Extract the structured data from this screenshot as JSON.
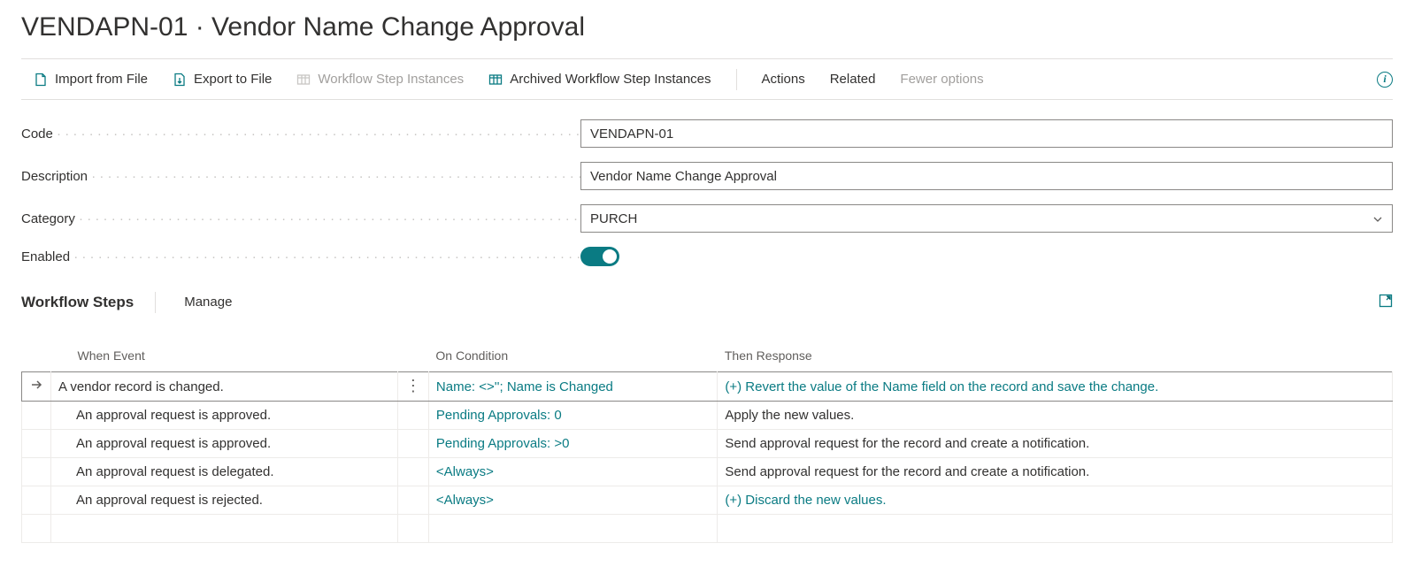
{
  "title": "VENDAPN-01 · Vendor Name Change Approval",
  "toolbar": {
    "import": "Import from File",
    "export": "Export to File",
    "wf_step_instances": "Workflow Step Instances",
    "archived_wf_step_instances": "Archived Workflow Step Instances",
    "actions": "Actions",
    "related": "Related",
    "fewer_options": "Fewer options"
  },
  "form": {
    "code_label": "Code",
    "code_value": "VENDAPN-01",
    "description_label": "Description",
    "description_value": "Vendor Name Change Approval",
    "category_label": "Category",
    "category_value": "PURCH",
    "enabled_label": "Enabled"
  },
  "section": {
    "title": "Workflow Steps",
    "manage": "Manage"
  },
  "grid": {
    "headers": {
      "event": "When Event",
      "condition": "On Condition",
      "response": "Then Response"
    },
    "rows": [
      {
        "selected": true,
        "indent": 0,
        "event": "A vendor record is changed.",
        "condition": "Name: <>''; Name is Changed",
        "response": "(+) Revert the value of the Name field on the record and save the change.",
        "response_link": true
      },
      {
        "selected": false,
        "indent": 1,
        "event": "An approval request is approved.",
        "condition": "Pending Approvals: 0",
        "response": "Apply the new values.",
        "response_link": false
      },
      {
        "selected": false,
        "indent": 1,
        "event": "An approval request is approved.",
        "condition": "Pending Approvals: >0",
        "response": "Send approval request for the record and create a notification.",
        "response_link": false
      },
      {
        "selected": false,
        "indent": 1,
        "event": "An approval request is delegated.",
        "condition": "<Always>",
        "response": "Send approval request for the record and create a notification.",
        "response_link": false
      },
      {
        "selected": false,
        "indent": 1,
        "event": "An approval request is rejected.",
        "condition": "<Always>",
        "response": "(+) Discard the new values.",
        "response_link": true
      },
      {
        "selected": false,
        "indent": 0,
        "event": "",
        "condition": "",
        "response": "",
        "response_link": false
      }
    ]
  }
}
